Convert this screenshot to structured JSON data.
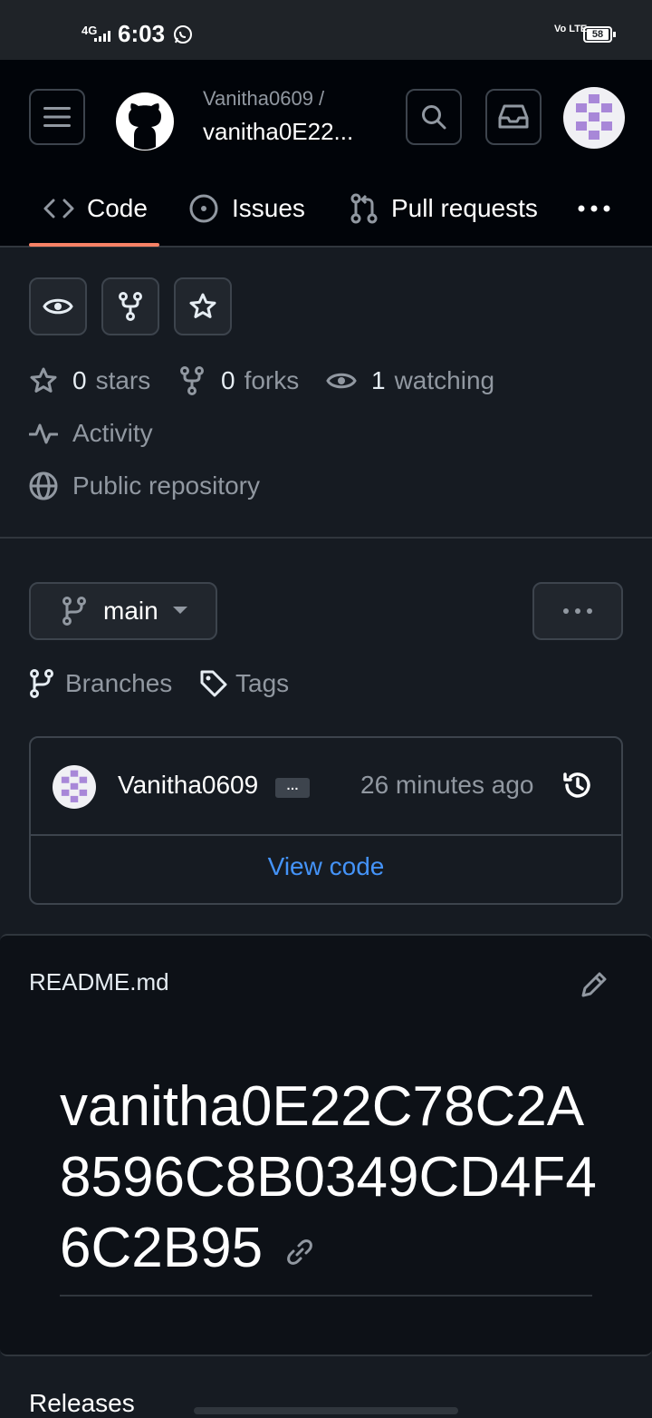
{
  "status_bar": {
    "network": "4G",
    "time": "6:03",
    "volte": "Vo LTE",
    "battery": "58"
  },
  "header": {
    "owner": "Vanitha0609 /",
    "repo_name": "vanitha0E22..."
  },
  "tabs": [
    {
      "label": "Code"
    },
    {
      "label": "Issues"
    },
    {
      "label": "Pull requests"
    }
  ],
  "stats": {
    "stars_count": "0",
    "stars_label": "stars",
    "forks_count": "0",
    "forks_label": "forks",
    "watching_count": "1",
    "watching_label": "watching",
    "activity": "Activity",
    "visibility": "Public repository"
  },
  "branch": {
    "current": "main",
    "branches_label": "Branches",
    "tags_label": "Tags"
  },
  "commit": {
    "user": "Vanitha0609",
    "ellipsis": "…",
    "time": "26 minutes ago",
    "view_code": "View code"
  },
  "readme": {
    "filename": "README.md",
    "heading": "vanitha0E22C78C2A8596C8B0349CD4F46C2B95"
  },
  "releases": {
    "title": "Releases"
  },
  "colors": {
    "accent_tab": "#f78166",
    "link": "#4493f8",
    "avatar_purple": "#a887d8"
  }
}
